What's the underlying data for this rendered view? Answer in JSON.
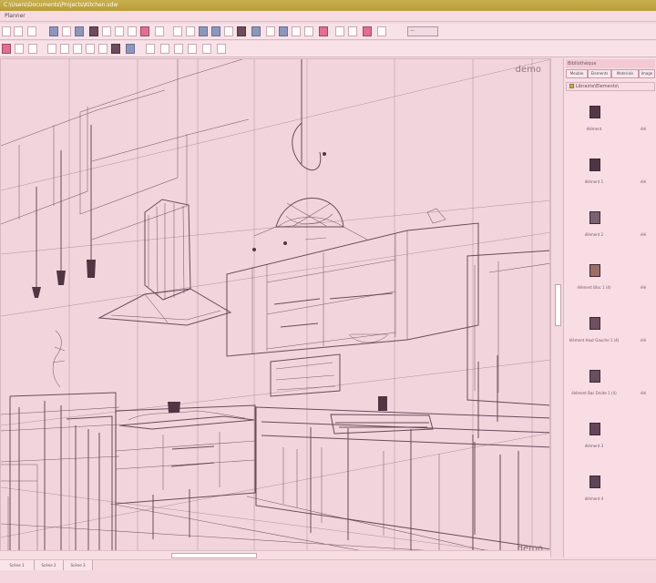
{
  "window": {
    "title": "C:\\Users\\Documents\\Projects\\Kitchen.sdw"
  },
  "menu": {
    "label": "Planner"
  },
  "toolbar": {
    "zoom_value": "—"
  },
  "viewport": {
    "label": "demo",
    "corner_label": "demo"
  },
  "panel": {
    "title": "Bibliothèque",
    "tabs": [
      "Meuble",
      "Elements",
      "Materials",
      "Image"
    ],
    "path": "Librairie\\Elements\\",
    "items": [
      {
        "label": "élément",
        "right_label": "élé",
        "icon": "pendant-light-icon"
      },
      {
        "label": "élément 1",
        "right_label": "élé",
        "icon": "ceiling-light-icon"
      },
      {
        "label": "élément 2",
        "right_label": "élé",
        "icon": "kitchen-tap-icon"
      },
      {
        "label": "élément Bloc 1 (4)",
        "right_label": "élé",
        "icon": "cupboard-icon"
      },
      {
        "label": "élément Haut Gauche 1 (4)",
        "right_label": "élé",
        "icon": "cabinet-icon"
      },
      {
        "label": "élément Bas Droite 1 (4)",
        "right_label": "élé",
        "icon": "drawer-unit-icon"
      },
      {
        "label": "élément 3",
        "right_label": "",
        "icon": "cooker-icon"
      },
      {
        "label": "élément 4",
        "right_label": "",
        "icon": "fridge-icon"
      }
    ]
  },
  "scene_tabs": [
    "Scène 1",
    "Scène 2",
    "Scène 3"
  ],
  "colors": {
    "titlebar": "#c0a448",
    "background": "#f3d8df",
    "linework": "#5a3c4b"
  }
}
